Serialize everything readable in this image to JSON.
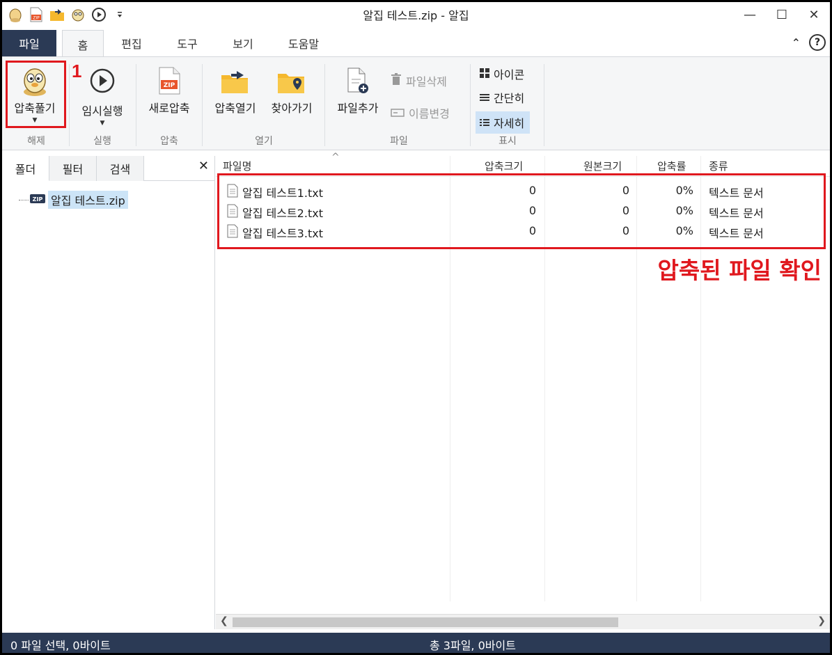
{
  "window": {
    "title": "알집 테스트.zip - 알집",
    "controls": {
      "minimize": "—",
      "maximize": "☐",
      "close": "✕"
    }
  },
  "quick_access": [
    "alzip-logo-icon",
    "zip-icon",
    "open-folder-icon",
    "extract-icon",
    "play-icon",
    "dropdown-icon"
  ],
  "ribbon_tabs": [
    {
      "label": "파일",
      "active": false
    },
    {
      "label": "홈",
      "active": true
    },
    {
      "label": "편집",
      "active": false
    },
    {
      "label": "도구",
      "active": false
    },
    {
      "label": "보기",
      "active": false
    },
    {
      "label": "도움말",
      "active": false
    }
  ],
  "ribbon_right": {
    "collapse": "⌃",
    "help": "?"
  },
  "ribbon": {
    "extract": {
      "label": "압축풀기",
      "group": "해제"
    },
    "run": {
      "label": "임시실행",
      "group": "실행"
    },
    "new_zip": {
      "label": "새로압축",
      "group": "압축"
    },
    "open_zip": {
      "label": "압축열기"
    },
    "goto": {
      "label": "찾아가기"
    },
    "open_group": "열기",
    "add_file": {
      "label": "파일추가"
    },
    "delete_file": {
      "label": "파일삭제"
    },
    "rename": {
      "label": "이름변경"
    },
    "file_group": "파일",
    "view_icons": {
      "label": "아이콘"
    },
    "view_simple": {
      "label": "간단히"
    },
    "view_detail": {
      "label": "자세히"
    },
    "view_group": "표시"
  },
  "annotation": {
    "step_number": "1",
    "note": "압축된 파일 확인",
    "color": "#e0181e"
  },
  "left_panel": {
    "tabs": [
      "폴더",
      "필터",
      "검색"
    ],
    "close": "✕",
    "tree": [
      {
        "label": "알집 테스트.zip",
        "icon": "zip-icon"
      }
    ]
  },
  "file_list": {
    "columns": [
      "파일명",
      "압축크기",
      "원본크기",
      "압축률",
      "종류"
    ],
    "sort_indicator": "^",
    "rows": [
      {
        "name": "알집 테스트1.txt",
        "compressed": "0",
        "original": "0",
        "ratio": "0%",
        "type": "텍스트 문서"
      },
      {
        "name": "알집 테스트2.txt",
        "compressed": "0",
        "original": "0",
        "ratio": "0%",
        "type": "텍스트 문서"
      },
      {
        "name": "알집 테스트3.txt",
        "compressed": "0",
        "original": "0",
        "ratio": "0%",
        "type": "텍스트 문서"
      }
    ]
  },
  "status": {
    "left": "0 파일 선택,  0바이트",
    "center": "총 3파일,  0바이트"
  },
  "colors": {
    "accent_dark": "#2b3a55",
    "ribbon_bg": "#f5f6f7",
    "selected": "#cce4f7"
  }
}
